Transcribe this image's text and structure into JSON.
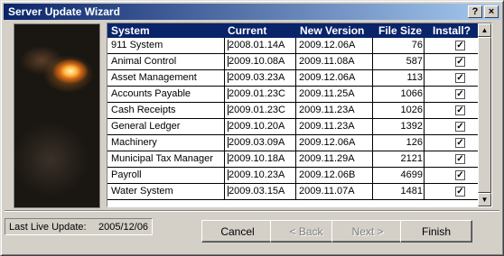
{
  "window": {
    "title": "Server Update Wizard",
    "help_label": "?",
    "close_label": "×"
  },
  "grid": {
    "headers": {
      "system": "System",
      "current": "Current",
      "new_version": "New Version",
      "file_size": "File Size",
      "install": "Install?"
    },
    "rows": [
      {
        "system": "911 System",
        "current": "2008.01.14A",
        "new_version": "2009.12.06A",
        "file_size": "76",
        "install": true
      },
      {
        "system": "Animal Control",
        "current": "2009.10.08A",
        "new_version": "2009.11.08A",
        "file_size": "587",
        "install": true
      },
      {
        "system": "Asset Management",
        "current": "2009.03.23A",
        "new_version": "2009.12.06A",
        "file_size": "113",
        "install": true
      },
      {
        "system": "Accounts Payable",
        "current": "2009.01.23C",
        "new_version": "2009.11.25A",
        "file_size": "1066",
        "install": true
      },
      {
        "system": "Cash Receipts",
        "current": "2009.01.23C",
        "new_version": "2009.11.23A",
        "file_size": "1026",
        "install": true
      },
      {
        "system": "General Ledger",
        "current": "2009.10.20A",
        "new_version": "2009.11.23A",
        "file_size": "1392",
        "install": true
      },
      {
        "system": "Machinery",
        "current": "2009.03.09A",
        "new_version": "2009.12.06A",
        "file_size": "126",
        "install": true
      },
      {
        "system": "Municipal Tax Manager",
        "current": "2009.10.18A",
        "new_version": "2009.11.29A",
        "file_size": "2121",
        "install": true
      },
      {
        "system": "Payroll",
        "current": "2009.10.23A",
        "new_version": "2009.12.06B",
        "file_size": "4699",
        "install": true
      },
      {
        "system": "Water System",
        "current": "2009.03.15A",
        "new_version": "2009.11.07A",
        "file_size": "1481",
        "install": true
      }
    ],
    "check_glyph": "✓"
  },
  "scroll": {
    "up_glyph": "▲",
    "down_glyph": "▼"
  },
  "status": {
    "label": "Last Live Update:",
    "value": "2005/12/06"
  },
  "buttons": {
    "cancel": "Cancel",
    "back": "< Back",
    "next": "Next >",
    "finish": "Finish"
  },
  "colors": {
    "header_bg": "#0a246a",
    "title_gradient_end": "#a6caf0",
    "dialog_bg": "#d4d0c8"
  }
}
